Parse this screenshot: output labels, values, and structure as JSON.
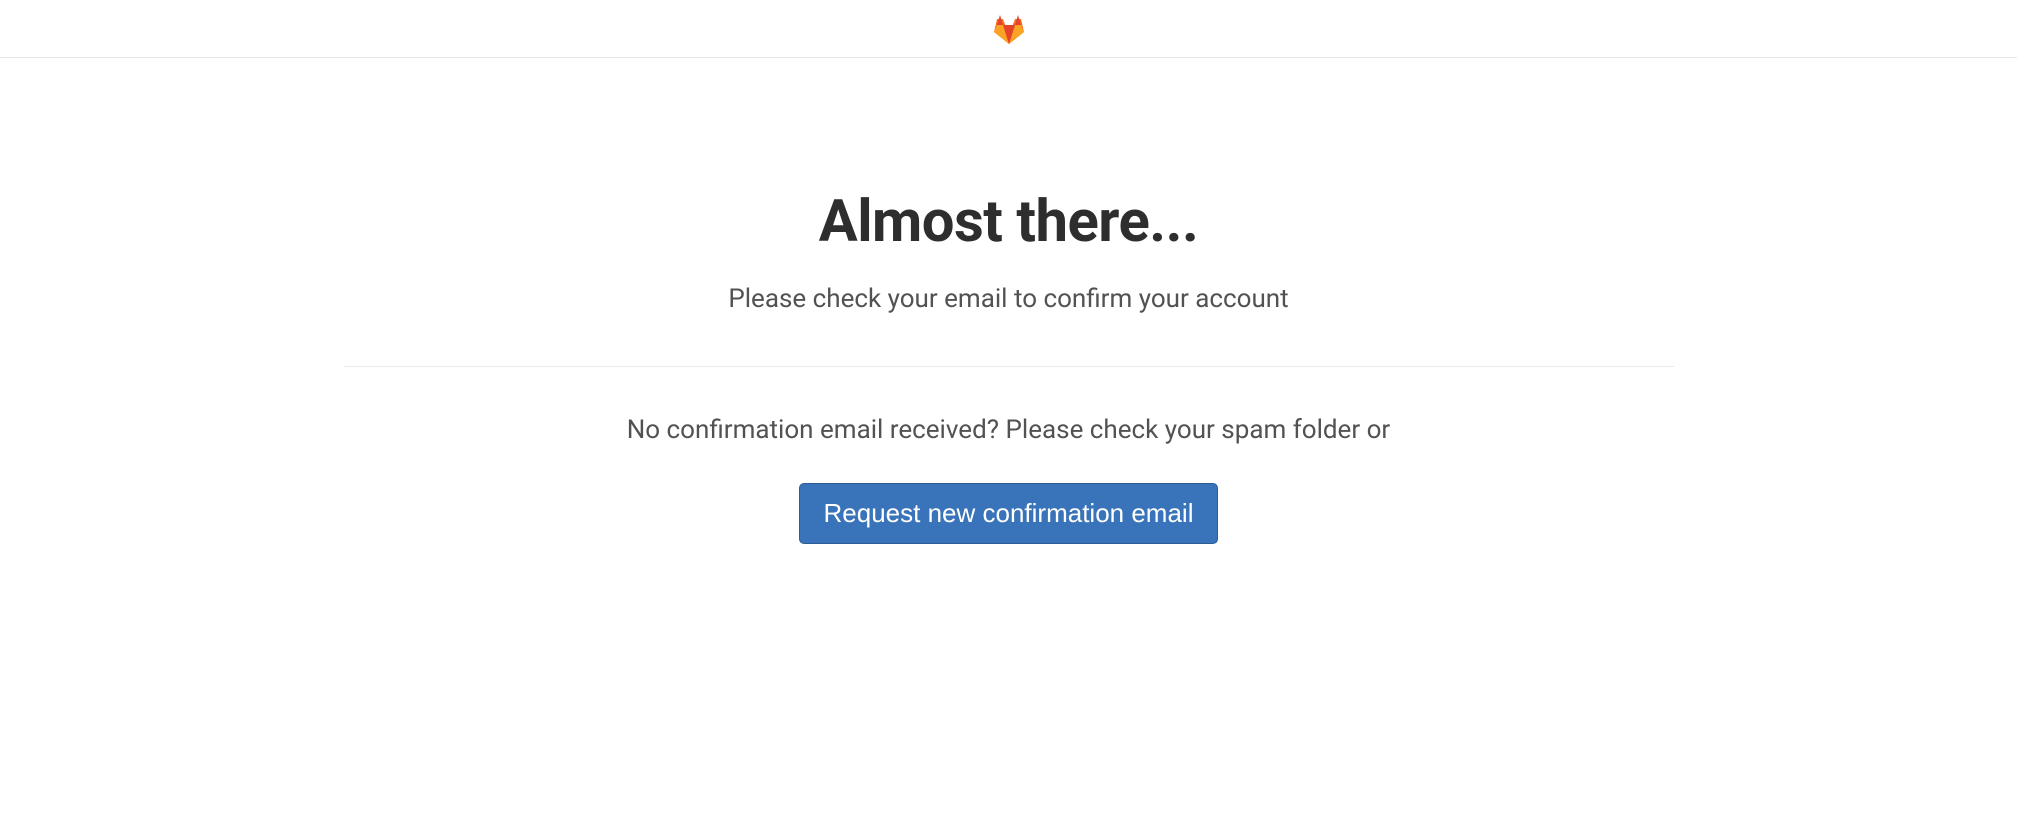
{
  "header": {
    "logo_name": "gitlab-logo"
  },
  "main": {
    "title": "Almost there...",
    "subtitle": "Please check your email to confirm your account",
    "help_text": "No confirmation email received? Please check your spam folder or",
    "button_label": "Request new confirmation email"
  }
}
